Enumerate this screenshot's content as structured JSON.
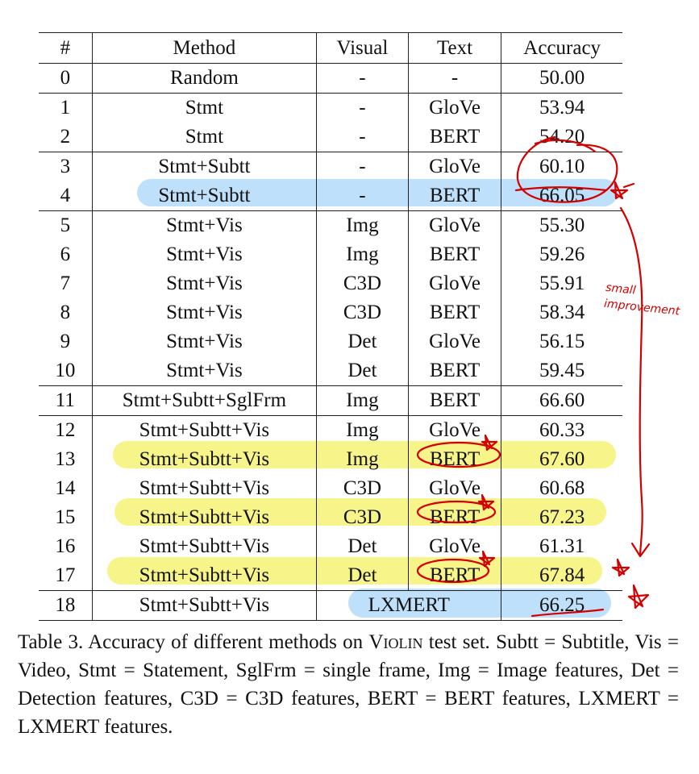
{
  "table": {
    "headers": {
      "id": "#",
      "method": "Method",
      "visual": "Visual",
      "text": "Text",
      "accuracy": "Accuracy"
    },
    "rows": [
      {
        "id": "0",
        "method": "Random",
        "visual": "-",
        "text": "-",
        "accuracy": "50.00"
      },
      {
        "id": "1",
        "method": "Stmt",
        "visual": "-",
        "text": "GloVe",
        "accuracy": "53.94"
      },
      {
        "id": "2",
        "method": "Stmt",
        "visual": "-",
        "text": "BERT",
        "accuracy": "54.20",
        "bold": true
      },
      {
        "id": "3",
        "method": "Stmt+Subtt",
        "visual": "-",
        "text": "GloVe",
        "accuracy": "60.10"
      },
      {
        "id": "4",
        "method": "Stmt+Subtt",
        "visual": "-",
        "text": "BERT",
        "accuracy": "66.05",
        "bold": true
      },
      {
        "id": "5",
        "method": "Stmt+Vis",
        "visual": "Img",
        "text": "GloVe",
        "accuracy": "55.30"
      },
      {
        "id": "6",
        "method": "Stmt+Vis",
        "visual": "Img",
        "text": "BERT",
        "accuracy": "59.26"
      },
      {
        "id": "7",
        "method": "Stmt+Vis",
        "visual": "C3D",
        "text": "GloVe",
        "accuracy": "55.91"
      },
      {
        "id": "8",
        "method": "Stmt+Vis",
        "visual": "C3D",
        "text": "BERT",
        "accuracy": "58.34"
      },
      {
        "id": "9",
        "method": "Stmt+Vis",
        "visual": "Det",
        "text": "GloVe",
        "accuracy": "56.15"
      },
      {
        "id": "10",
        "method": "Stmt+Vis",
        "visual": "Det",
        "text": "BERT",
        "accuracy": "59.45",
        "bold": true
      },
      {
        "id": "11",
        "method": "Stmt+Subtt+SglFrm",
        "visual": "Img",
        "text": "BERT",
        "accuracy": "66.60"
      },
      {
        "id": "12",
        "method": "Stmt+Subtt+Vis",
        "visual": "Img",
        "text": "GloVe",
        "accuracy": "60.33"
      },
      {
        "id": "13",
        "method": "Stmt+Subtt+Vis",
        "visual": "Img",
        "text": "BERT",
        "accuracy": "67.60"
      },
      {
        "id": "14",
        "method": "Stmt+Subtt+Vis",
        "visual": "C3D",
        "text": "GloVe",
        "accuracy": "60.68"
      },
      {
        "id": "15",
        "method": "Stmt+Subtt+Vis",
        "visual": "C3D",
        "text": "BERT",
        "accuracy": "67.23"
      },
      {
        "id": "16",
        "method": "Stmt+Subtt+Vis",
        "visual": "Det",
        "text": "GloVe",
        "accuracy": "61.31"
      },
      {
        "id": "17",
        "method": "Stmt+Subtt+Vis",
        "visual": "Det",
        "text": "BERT",
        "accuracy": "67.84",
        "bold": true
      },
      {
        "id": "18",
        "method": "Stmt+Subtt+Vis",
        "visual_text": "LXMERT",
        "accuracy": "66.25"
      }
    ]
  },
  "caption": {
    "prefix": "Table 3. Accuracy of different methods on ",
    "dataset": "Violin",
    "suffix": " test set. Subtt = Subtitle, Vis = Video, Stmt = Statement, SglFrm = single frame, Img = Image features, Det = Detection features, C3D = C3D features, BERT = BERT features, LXMERT = LXMERT features."
  },
  "annotations": {
    "margin_note_lines": [
      "small",
      "improvement"
    ],
    "ink_color": "#d40000",
    "highlight_colors": {
      "blue": "#bfe0fb",
      "yellow": "#f7f48a"
    }
  }
}
